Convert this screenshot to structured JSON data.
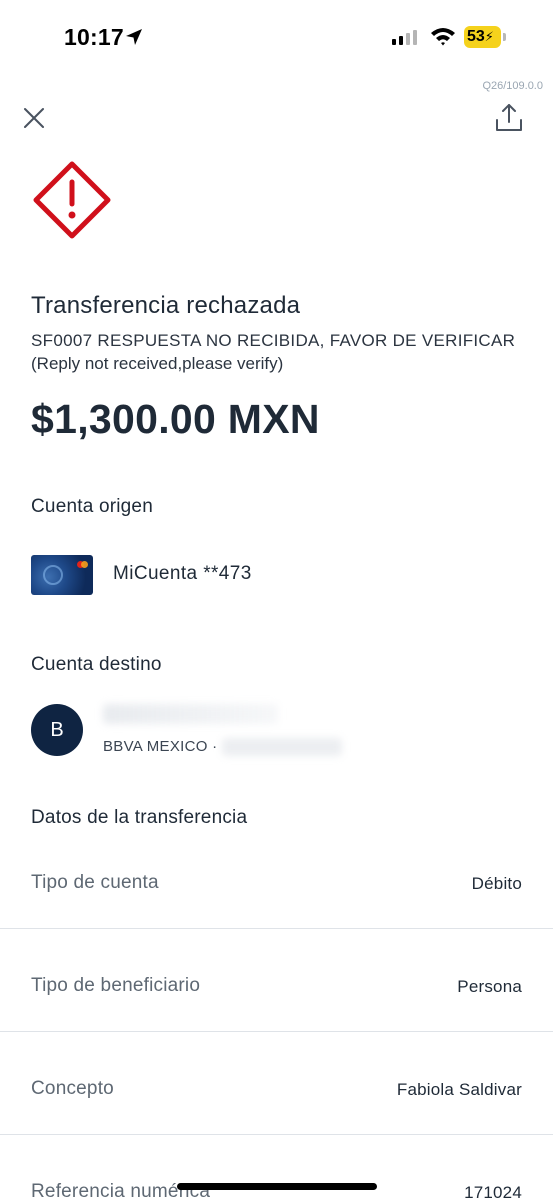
{
  "status_bar": {
    "time": "10:17",
    "battery": "53"
  },
  "version": "Q26/109.0.0",
  "header": {
    "close_icon": "close-icon",
    "share_icon": "share-icon"
  },
  "status": {
    "icon": "warning-diamond-icon",
    "icon_color": "#d0101b",
    "title": "Transferencia rechazada",
    "error_code": "SF0007  RESPUESTA NO RECIBIDA, FAVOR DE VERIFICAR",
    "error_en": "(Reply not received,please verify)",
    "amount": "$1,300.00 MXN"
  },
  "origin": {
    "title": "Cuenta origen",
    "account": "MiCuenta  **473"
  },
  "destination": {
    "title": "Cuenta destino",
    "avatar_initial": "B",
    "bank": "BBVA MEXICO ·"
  },
  "transfer": {
    "title": "Datos de la transferencia",
    "rows": [
      {
        "label": "Tipo de cuenta",
        "value": "Débito"
      },
      {
        "label": "Tipo de beneficiario",
        "value": "Persona"
      },
      {
        "label": "Concepto",
        "value": "Fabiola Saldivar"
      },
      {
        "label": "Referencia numérica",
        "value": "171024"
      }
    ]
  },
  "colors": {
    "accent_dark": "#0f2442",
    "battery": "#f5d21c",
    "text": "#1f2a37"
  }
}
